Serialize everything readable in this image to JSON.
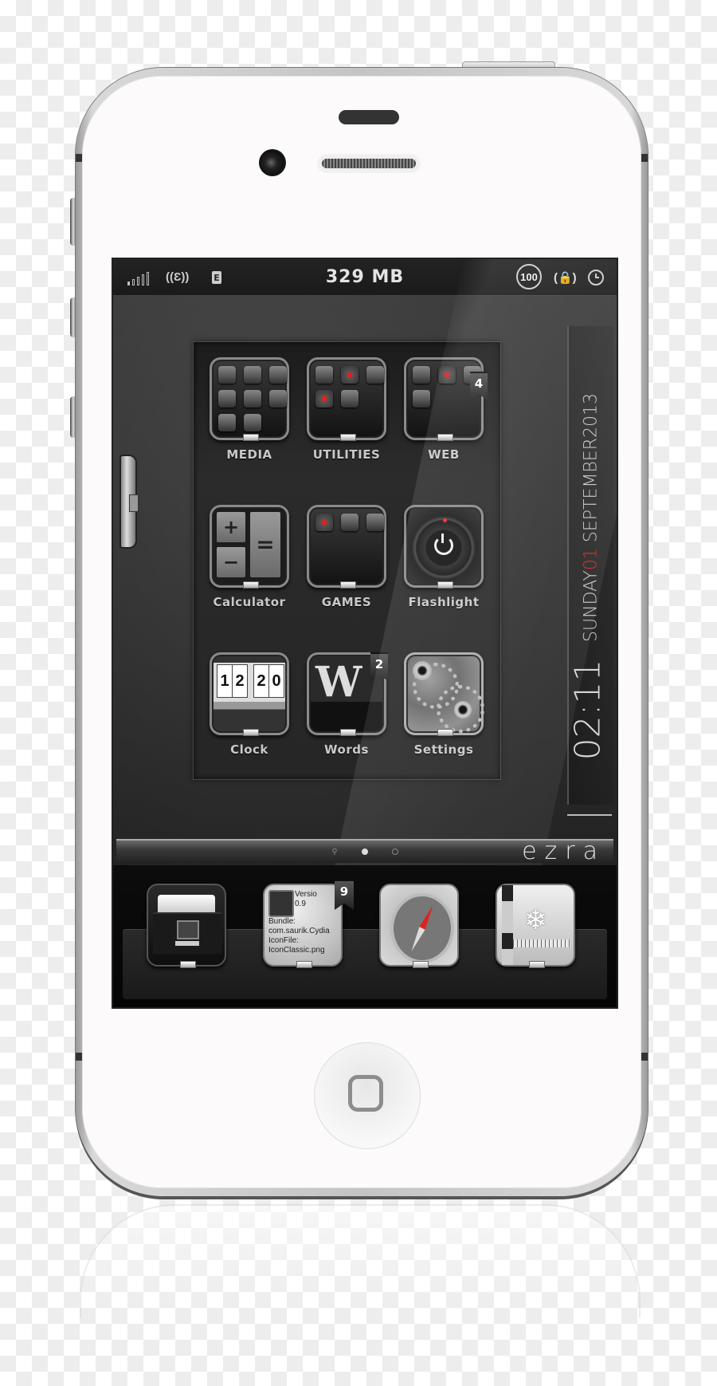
{
  "statusbar": {
    "signal_icon": "signal-bars-icon",
    "network_icon": "network-e-icon",
    "carrier_badge": "E",
    "memory": "329 MB",
    "battery": "100",
    "rotation_lock_icon": "rotation-lock-icon",
    "alarm_icon": "alarm-clock-icon"
  },
  "folders": [
    {
      "label": "MEDIA",
      "badge": null
    },
    {
      "label": "UTILITIES",
      "badge": null
    },
    {
      "label": "WEB",
      "badge": "4"
    }
  ],
  "apps": [
    {
      "label": "Calculator"
    },
    {
      "label": "GAMES"
    },
    {
      "label": "Flashlight"
    },
    {
      "label": "Clock",
      "digits": [
        "1",
        "2",
        "2",
        "0"
      ]
    },
    {
      "label": "Words",
      "badge": "2",
      "glyph": "W"
    },
    {
      "label": "Settings"
    }
  ],
  "calculator_keys": [
    "+",
    "−",
    "="
  ],
  "date": {
    "day": "SUNDAY",
    "date_num": "01",
    "month_year": "SEPTEMBER2013",
    "time": "02:11",
    "accent_color": "#e01e1e"
  },
  "page_indicator": {
    "pages": 3,
    "active_index": 1,
    "search_icon": "spotlight-search-icon"
  },
  "brand": "ezra",
  "dock": [
    {
      "name": "files",
      "icon": "file-cabinet-icon"
    },
    {
      "name": "cydia",
      "icon": "cydia-icon",
      "badge": "9",
      "text": "Versio\n0.9\nBundle:\ncom.saurik.Cydia\nIconFile:\nIconClassic.png"
    },
    {
      "name": "safari",
      "icon": "compass-icon"
    },
    {
      "name": "notes",
      "icon": "snowflake-icon"
    }
  ]
}
